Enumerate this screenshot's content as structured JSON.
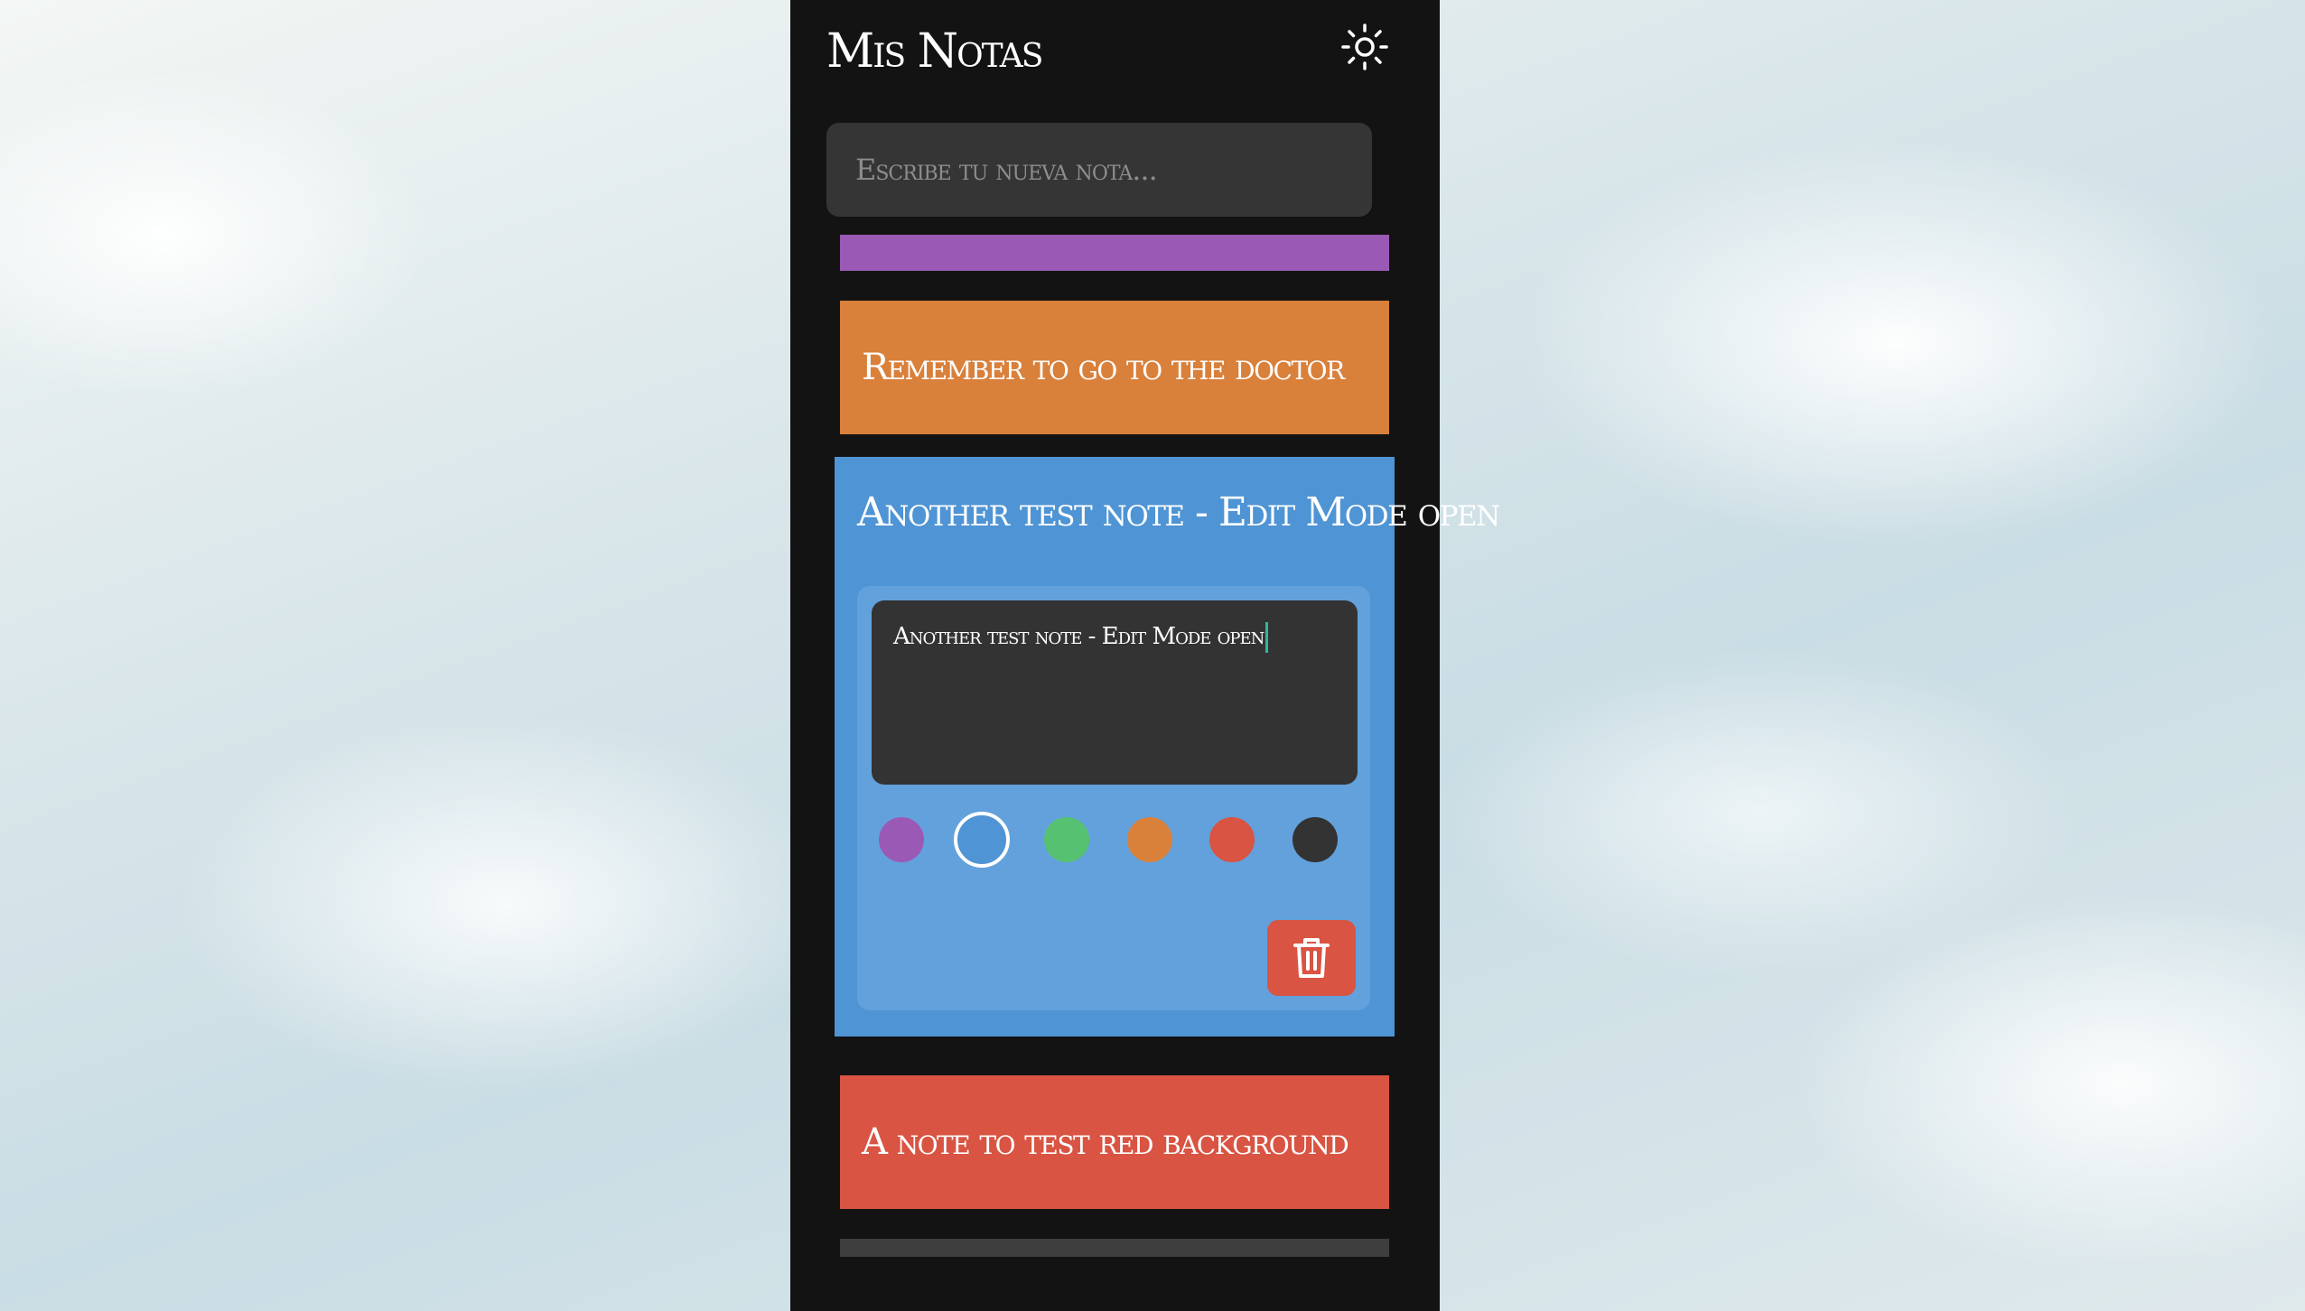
{
  "app": {
    "title": "Mis Notas"
  },
  "header": {
    "theme_icon": "sun-icon"
  },
  "new_note": {
    "placeholder": "Escribe tu nueva nota...",
    "value": ""
  },
  "notes": [
    {
      "text": "",
      "color": "#9b59b6"
    },
    {
      "text": "Remember to go to the doctor",
      "color": "#d9803b"
    },
    {
      "text": "Another test note - Edit Mode open",
      "color": "#4f94d4",
      "editing": true
    },
    {
      "text": "A note to test red background",
      "color": "#d95443"
    },
    {
      "text": "",
      "color": "#3e3e3e"
    }
  ],
  "editor": {
    "value": "Another test note - Edit Mode open",
    "selected_color": "#4f94d4",
    "colors": [
      "#9b59b6",
      "#4f94d4",
      "#56c271",
      "#d9803b",
      "#d95443",
      "#333333"
    ],
    "delete_icon": "trash-icon"
  }
}
